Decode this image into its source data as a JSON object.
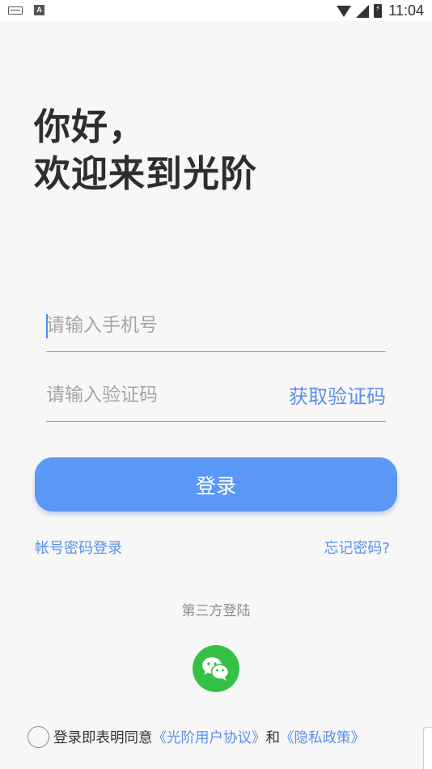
{
  "status_bar": {
    "time": "11:04",
    "left_icons": [
      "keyboard-icon",
      "a-notification-icon"
    ],
    "right_icons": [
      "wifi-icon",
      "cell-signal-icon",
      "battery-charging-icon"
    ]
  },
  "greeting": {
    "line1": "你好，",
    "line2": "欢迎来到光阶"
  },
  "form": {
    "phone_placeholder": "请输入手机号",
    "code_placeholder": "请输入验证码",
    "get_code_label": "获取验证码",
    "login_label": "登录"
  },
  "links": {
    "password_login": "帐号密码登录",
    "forgot_password": "忘记密码?"
  },
  "third_party": {
    "label": "第三方登陆",
    "icon": "wechat-icon",
    "color": "#35c046"
  },
  "agreement": {
    "prefix": "登录即表明同意",
    "user_agreement": "《光阶用户协议》",
    "and": "和",
    "privacy_policy": "《隐私政策》"
  },
  "colors": {
    "accent": "#5b97f5",
    "link": "#5b8fe8",
    "background": "#f7f7f7"
  }
}
